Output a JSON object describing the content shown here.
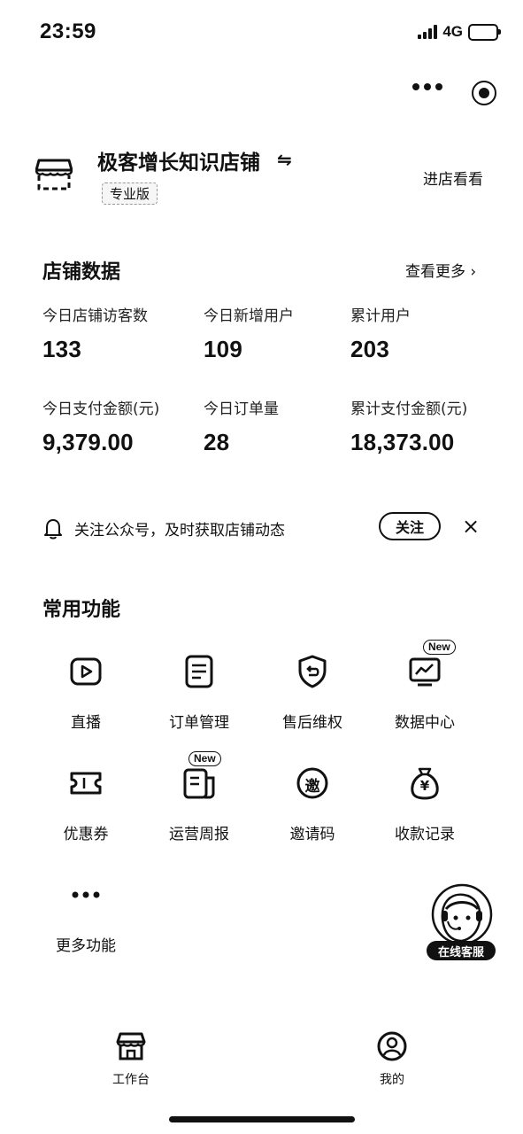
{
  "status_bar": {
    "time": "23:59",
    "network": "4G"
  },
  "store": {
    "name": "极客增长知识店铺",
    "edition": "专业版",
    "visit_label": "进店看看"
  },
  "store_data": {
    "title": "店铺数据",
    "see_more": "查看更多 ›",
    "metrics": [
      {
        "label": "今日店铺访客数",
        "value": "133"
      },
      {
        "label": "今日新增用户",
        "value": "109"
      },
      {
        "label": "累计用户",
        "value": "203"
      },
      {
        "label": "今日支付金额(元)",
        "value": "9,379.00"
      },
      {
        "label": "今日订单量",
        "value": "28"
      },
      {
        "label": "累计支付金额(元)",
        "value": "18,373.00"
      }
    ]
  },
  "notice": {
    "text": "关注公众号，及时获取店铺动态",
    "follow_label": "关注",
    "close_symbol": "×"
  },
  "functions": {
    "title": "常用功能",
    "new_badge": "New",
    "items": [
      {
        "label": "直播",
        "icon": "live-icon"
      },
      {
        "label": "订单管理",
        "icon": "order-icon"
      },
      {
        "label": "售后维权",
        "icon": "after-sale-icon"
      },
      {
        "label": "数据中心",
        "icon": "data-center-icon"
      },
      {
        "label": "优惠券",
        "icon": "coupon-icon"
      },
      {
        "label": "运营周报",
        "icon": "weekly-report-icon"
      },
      {
        "label": "邀请码",
        "icon": "invite-code-icon",
        "glyph": "邀"
      },
      {
        "label": "收款记录",
        "icon": "payment-record-icon",
        "glyph": "¥"
      },
      {
        "label": "更多功能",
        "icon": "more-icon"
      }
    ]
  },
  "service": {
    "label": "在线客服"
  },
  "tabbar": [
    {
      "label": "工作台",
      "icon": "workbench-icon",
      "active": true
    },
    {
      "label": "我的",
      "icon": "profile-icon",
      "active": false
    }
  ]
}
